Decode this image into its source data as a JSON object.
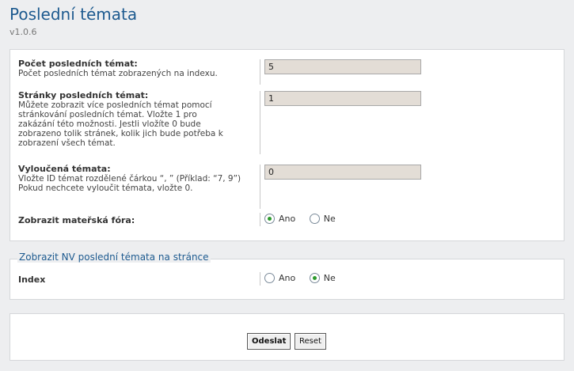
{
  "header": {
    "title": "Poslední témata",
    "version": "v1.0.6"
  },
  "settings": {
    "count": {
      "name": "Počet posledních témat:",
      "desc": "Počet posledních témat zobrazených na indexu.",
      "value": "5"
    },
    "pages": {
      "name": "Stránky posledních témat:",
      "desc": "Můžete zobrazit více posledních témat pomocí stránkování posledních témat. Vložte 1 pro zakázání této možnosti. Jestli vložíte 0 bude zobrazeno tolik stránek, kolik jich bude potřeba k zobrazení všech témat.",
      "value": "1"
    },
    "excluded": {
      "name": "Vyloučená témata:",
      "desc1": "Vložte ID témat rozdělené čárkou “, ” (Příklad: “7, 9”)",
      "desc2": "Pokud nechcete vyloučit témata, vložte 0.",
      "value": "0"
    },
    "parents": {
      "name": "Zobrazit mateřská fóra:",
      "opt_yes": "Ano",
      "opt_no": "Ne",
      "selected": "Ano"
    }
  },
  "display": {
    "legend": "Zobrazit NV poslední témata na stránce",
    "index": {
      "name": "Index",
      "opt_yes": "Ano",
      "opt_no": "Ne",
      "selected": "Ne"
    }
  },
  "buttons": {
    "submit": "Odeslat",
    "reset": "Reset"
  }
}
